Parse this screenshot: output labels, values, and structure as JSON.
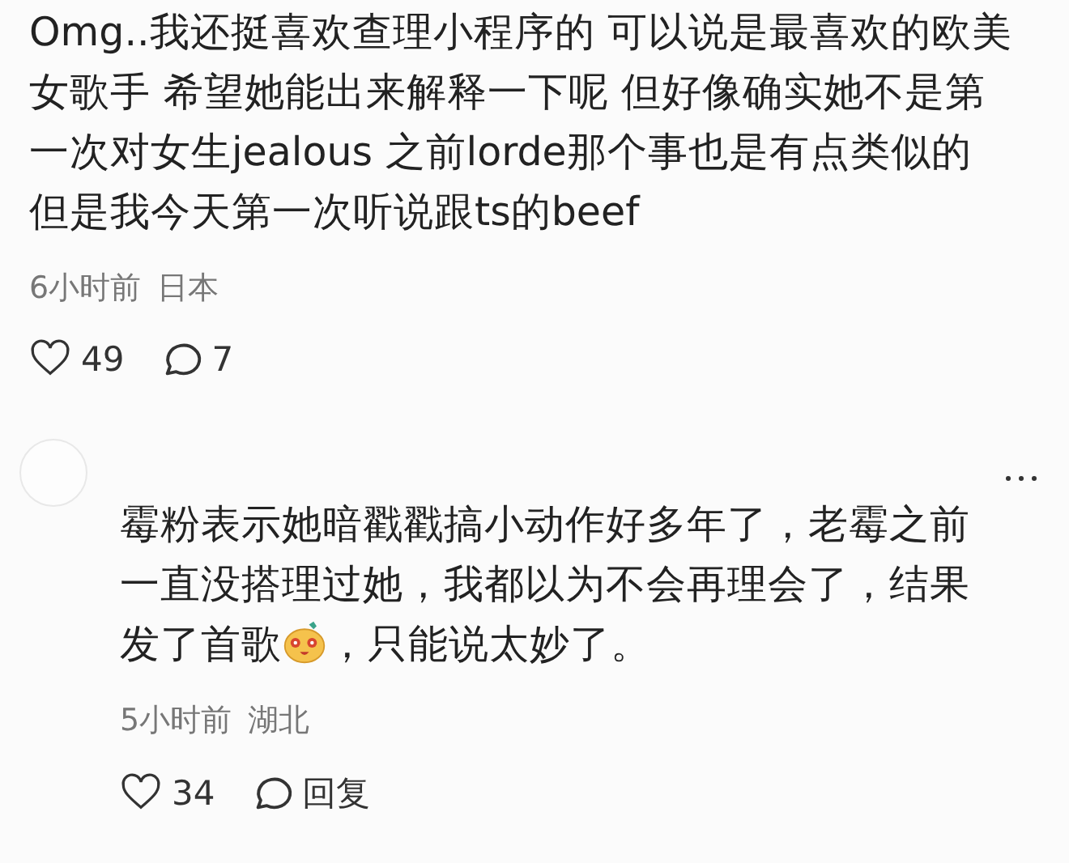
{
  "comments": [
    {
      "kind": "top",
      "lines": [
        [
          {
            "kind": "text",
            "text": "Omg..我还挺喜欢查理小程序的 可以说是最喜欢的欧美"
          }
        ],
        [
          {
            "kind": "text",
            "text": "女歌手 希望她能出来解释一下呢 但好像确实她不是第"
          }
        ],
        [
          {
            "kind": "text",
            "text": "一次对女生jealous 之前lorde那个事也是有点类似的"
          }
        ],
        [
          {
            "kind": "text",
            "text": "但是我今天第一次听说跟ts的beef"
          }
        ]
      ],
      "time": "6小时前",
      "location": "日本",
      "likes": "49",
      "reply_label": "7"
    },
    {
      "kind": "reply",
      "lines": [
        [
          {
            "kind": "text",
            "text": "霉粉表示她暗戳戳搞小动作好多年了，老霉之前"
          }
        ],
        [
          {
            "kind": "text",
            "text": "一直没搭理过她，我都以为不会再理会了，结果"
          }
        ],
        [
          {
            "kind": "text",
            "text": "发了首歌"
          },
          {
            "kind": "emoji"
          },
          {
            "kind": "text",
            "text": "，只能说太妙了。"
          }
        ]
      ],
      "time": "5小时前",
      "location": "湖北",
      "likes": "34",
      "reply_label": "回复"
    }
  ]
}
